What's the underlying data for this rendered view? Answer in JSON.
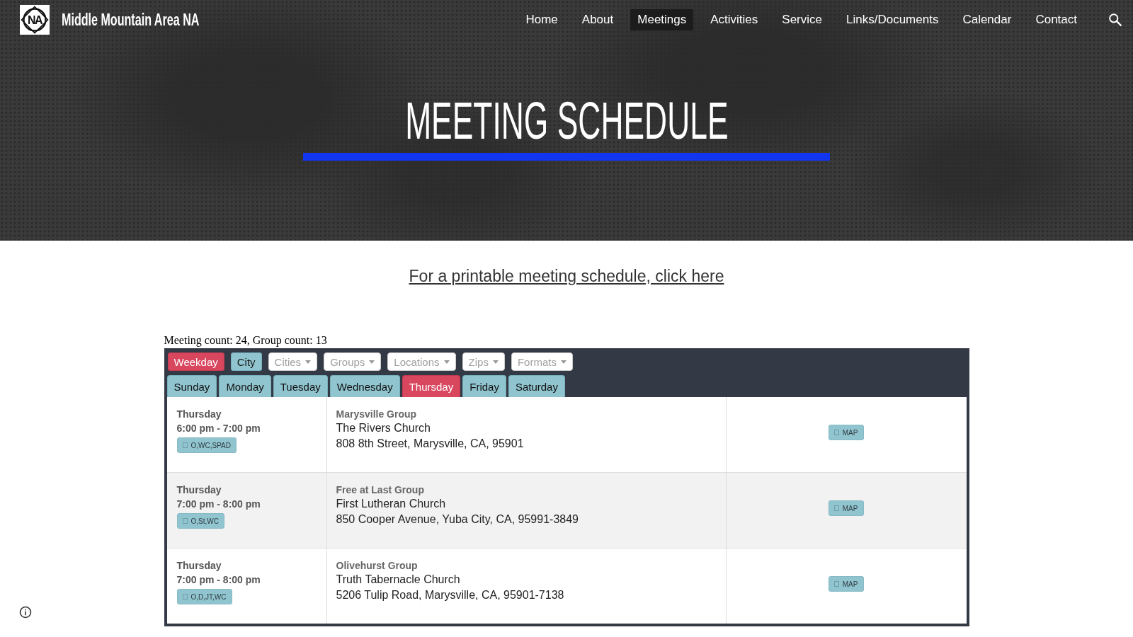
{
  "site": {
    "logo_text": "NA",
    "title": "Middle Mountain Area NA"
  },
  "nav": [
    {
      "label": "Home",
      "selected": false
    },
    {
      "label": "About",
      "selected": false
    },
    {
      "label": "Meetings",
      "selected": true
    },
    {
      "label": "Activities",
      "selected": false
    },
    {
      "label": "Service",
      "selected": false
    },
    {
      "label": "Links/Documents",
      "selected": false
    },
    {
      "label": "Calendar",
      "selected": false
    },
    {
      "label": "Contact",
      "selected": false
    }
  ],
  "hero": {
    "title": "MEETING SCHEDULE"
  },
  "printable_link": "For a printable meeting schedule, click here",
  "meeting_summary": "Meeting count: 24, Group count: 13",
  "view_toggles": [
    {
      "label": "Weekday",
      "selected": true
    },
    {
      "label": "City",
      "selected": false
    }
  ],
  "filters": [
    {
      "placeholder": "Cities"
    },
    {
      "placeholder": "Groups"
    },
    {
      "placeholder": "Locations"
    },
    {
      "placeholder": "Zips"
    },
    {
      "placeholder": "Formats"
    }
  ],
  "day_tabs": [
    {
      "label": "Sunday",
      "selected": false
    },
    {
      "label": "Monday",
      "selected": false
    },
    {
      "label": "Tuesday",
      "selected": false
    },
    {
      "label": "Wednesday",
      "selected": false
    },
    {
      "label": "Thursday",
      "selected": true
    },
    {
      "label": "Friday",
      "selected": false
    },
    {
      "label": "Saturday",
      "selected": false
    }
  ],
  "meetings": [
    {
      "day": "Thursday",
      "time": "6:00 pm - 7:00 pm",
      "formats": "O,WC,SPAD",
      "group": "Marysville Group",
      "location": "The Rivers Church",
      "address": "808 8th Street, Marysville, CA, 95901",
      "map_label": "MAP"
    },
    {
      "day": "Thursday",
      "time": "7:00 pm - 8:00 pm",
      "formats": "O,St,WC",
      "group": "Free at Last Group",
      "location": "First Lutheran Church",
      "address": "850 Cooper Avenue, Yuba City, CA, 95991-3849",
      "map_label": "MAP"
    },
    {
      "day": "Thursday",
      "time": "7:00 pm - 8:00 pm",
      "formats": "O,D,JT,WC",
      "group": "Olivehurst Group",
      "location": "Truth Tabernacle Church",
      "address": "5206 Tulip Road, Marysville, CA, 95901-7138",
      "map_label": "MAP"
    }
  ]
}
